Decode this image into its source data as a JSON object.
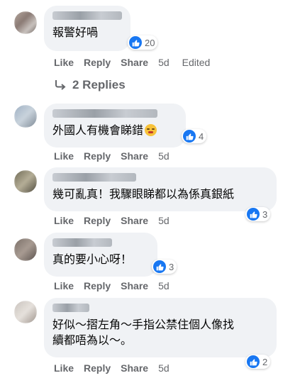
{
  "comments": [
    {
      "text": "報警好喎",
      "reaction_count": "20",
      "actions": {
        "like": "Like",
        "reply": "Reply",
        "share": "Share",
        "time": "5d",
        "edited": "Edited"
      },
      "replies_label": "2 Replies"
    },
    {
      "text": "外國人有機會睇錯",
      "emoji": "persevering-face-emoji",
      "reaction_count": "4",
      "actions": {
        "like": "Like",
        "reply": "Reply",
        "share": "Share",
        "time": "5d"
      }
    },
    {
      "text": "幾可亂真！我驟眼睇都以為係真銀紙",
      "reaction_count": "3",
      "actions": {
        "like": "Like",
        "reply": "Reply",
        "share": "Share",
        "time": "5d"
      }
    },
    {
      "text": "真的要小心呀！",
      "reaction_count": "3",
      "actions": {
        "like": "Like",
        "reply": "Reply",
        "share": "Share",
        "time": "5d"
      }
    },
    {
      "text": "好似～摺左角～手指公禁住個人像找\n續都唔為以～。",
      "reaction_count": "2",
      "actions": {
        "like": "Like",
        "reply": "Reply",
        "share": "Share",
        "time": "5d"
      }
    }
  ],
  "colors": {
    "bubble": "#f0f2f5",
    "like_blue": "#1877f2",
    "muted_text": "#65676b",
    "text": "#050505"
  },
  "icons": {
    "reaction": "like-thumb-icon",
    "reply_arrow": "reply-arrow-icon"
  }
}
